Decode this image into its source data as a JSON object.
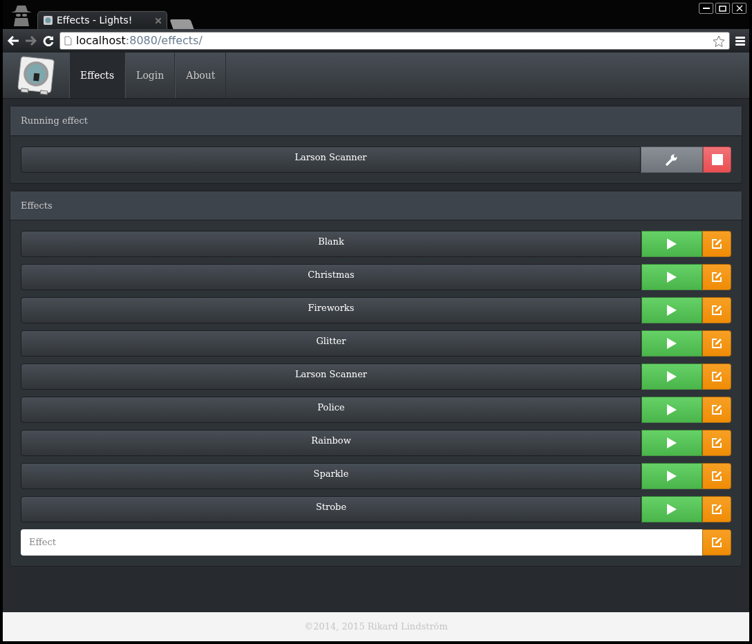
{
  "browser": {
    "tab_title": "Effects - Lights!",
    "url_host": "localhost",
    "url_path": ":8080/effects/"
  },
  "nav": [
    {
      "label": "Effects",
      "selected": true
    },
    {
      "label": "Login",
      "selected": false
    },
    {
      "label": "About",
      "selected": false
    }
  ],
  "running": {
    "title": "Running effect",
    "name": "Larson Scanner"
  },
  "effects": {
    "title": "Effects",
    "items": [
      "Blank",
      "Christmas",
      "Fireworks",
      "Glitter",
      "Larson Scanner",
      "Police",
      "Rainbow",
      "Sparkle",
      "Strobe"
    ],
    "new_field": {
      "placeholder": "Effect"
    }
  },
  "footer": "©2014, 2015 Rikard Lindström"
}
